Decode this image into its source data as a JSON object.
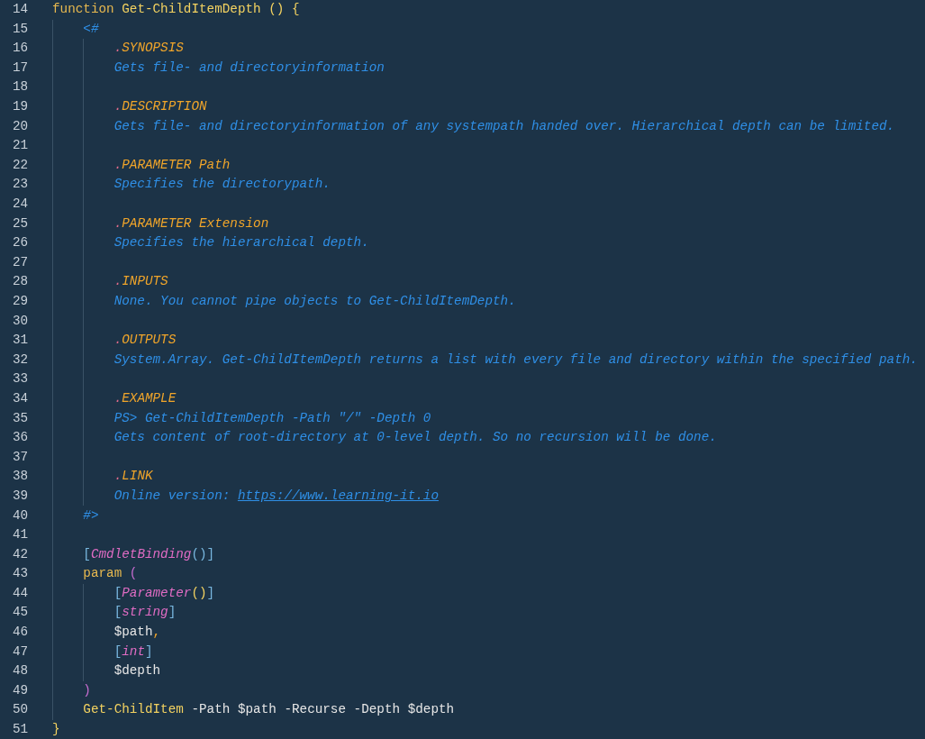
{
  "editor": {
    "lines": [
      {
        "number": "14",
        "tokens": [
          {
            "kind": "keyword",
            "text": "function "
          },
          {
            "kind": "function",
            "text": "Get-ChildItemDepth "
          },
          {
            "kind": "paren-yellow",
            "text": "() {"
          }
        ],
        "children": [
          {
            "number": "15",
            "tokens": [
              {
                "kind": "comment",
                "text": "<#"
              }
            ],
            "children": [
              {
                "number": "16",
                "tokens": [
                  {
                    "kind": "doc-dot",
                    "text": "."
                  },
                  {
                    "kind": "doc-keyword",
                    "text": "SYNOPSIS"
                  }
                ]
              },
              {
                "number": "17",
                "tokens": [
                  {
                    "kind": "comment",
                    "text": "Gets file- and directoryinformation"
                  }
                ]
              },
              {
                "number": "18"
              },
              {
                "number": "19",
                "tokens": [
                  {
                    "kind": "doc-dot",
                    "text": "."
                  },
                  {
                    "kind": "doc-keyword",
                    "text": "DESCRIPTION"
                  }
                ]
              },
              {
                "number": "20",
                "tokens": [
                  {
                    "kind": "comment",
                    "text": "Gets file- and directoryinformation of any systempath handed over. Hierarchical depth can be limited."
                  }
                ]
              },
              {
                "number": "21"
              },
              {
                "number": "22",
                "tokens": [
                  {
                    "kind": "doc-dot",
                    "text": "."
                  },
                  {
                    "kind": "doc-keyword",
                    "text": "PARAMETER Path"
                  }
                ]
              },
              {
                "number": "23",
                "tokens": [
                  {
                    "kind": "comment",
                    "text": "Specifies the directorypath."
                  }
                ]
              },
              {
                "number": "24"
              },
              {
                "number": "25",
                "tokens": [
                  {
                    "kind": "doc-dot",
                    "text": "."
                  },
                  {
                    "kind": "doc-keyword",
                    "text": "PARAMETER Extension"
                  }
                ]
              },
              {
                "number": "26",
                "tokens": [
                  {
                    "kind": "comment",
                    "text": "Specifies the hierarchical depth."
                  }
                ]
              },
              {
                "number": "27"
              },
              {
                "number": "28",
                "tokens": [
                  {
                    "kind": "doc-dot",
                    "text": "."
                  },
                  {
                    "kind": "doc-keyword",
                    "text": "INPUTS"
                  }
                ]
              },
              {
                "number": "29",
                "tokens": [
                  {
                    "kind": "comment",
                    "text": "None. You cannot pipe objects to Get-ChildItemDepth."
                  }
                ]
              },
              {
                "number": "30"
              },
              {
                "number": "31",
                "tokens": [
                  {
                    "kind": "doc-dot",
                    "text": "."
                  },
                  {
                    "kind": "doc-keyword",
                    "text": "OUTPUTS"
                  }
                ]
              },
              {
                "number": "32",
                "tokens": [
                  {
                    "kind": "comment",
                    "text": "System.Array. Get-ChildItemDepth returns a list with every file and directory within the specified path."
                  }
                ]
              },
              {
                "number": "33"
              },
              {
                "number": "34",
                "tokens": [
                  {
                    "kind": "doc-dot",
                    "text": "."
                  },
                  {
                    "kind": "doc-keyword",
                    "text": "EXAMPLE"
                  }
                ]
              },
              {
                "number": "35",
                "tokens": [
                  {
                    "kind": "comment",
                    "text": "PS> Get-ChildItemDepth -Path \"/\" -Depth 0"
                  }
                ]
              },
              {
                "number": "36",
                "tokens": [
                  {
                    "kind": "comment",
                    "text": "Gets content of root-directory at 0-level depth. So no recursion will be done."
                  }
                ]
              },
              {
                "number": "37"
              },
              {
                "number": "38",
                "tokens": [
                  {
                    "kind": "doc-dot",
                    "text": "."
                  },
                  {
                    "kind": "doc-keyword",
                    "text": "LINK"
                  }
                ]
              },
              {
                "number": "39",
                "tokens": [
                  {
                    "kind": "comment",
                    "text": "Online version: "
                  },
                  {
                    "kind": "link",
                    "text": "https://www.learning-it.io"
                  }
                ]
              }
            ]
          },
          {
            "number": "40",
            "tokens": [
              {
                "kind": "comment",
                "text": "#>"
              }
            ]
          },
          {
            "number": "41"
          },
          {
            "number": "42",
            "tokens": [
              {
                "kind": "bracket",
                "text": "["
              },
              {
                "kind": "type",
                "text": "CmdletBinding"
              },
              {
                "kind": "bracket",
                "text": "()]"
              }
            ]
          },
          {
            "number": "43",
            "tokens": [
              {
                "kind": "keyword",
                "text": "param "
              },
              {
                "kind": "paren-pink",
                "text": "("
              }
            ],
            "children": [
              {
                "number": "44",
                "tokens": [
                  {
                    "kind": "bracket",
                    "text": "["
                  },
                  {
                    "kind": "type",
                    "text": "Parameter"
                  },
                  {
                    "kind": "paren-yellow",
                    "text": "()"
                  },
                  {
                    "kind": "bracket",
                    "text": "]"
                  }
                ]
              },
              {
                "number": "45",
                "tokens": [
                  {
                    "kind": "bracket",
                    "text": "["
                  },
                  {
                    "kind": "type",
                    "text": "string"
                  },
                  {
                    "kind": "bracket",
                    "text": "]"
                  }
                ]
              },
              {
                "number": "46",
                "tokens": [
                  {
                    "kind": "variable",
                    "text": "$path"
                  },
                  {
                    "kind": "comma",
                    "text": ","
                  }
                ]
              },
              {
                "number": "47",
                "tokens": [
                  {
                    "kind": "bracket",
                    "text": "["
                  },
                  {
                    "kind": "type",
                    "text": "int"
                  },
                  {
                    "kind": "bracket",
                    "text": "]"
                  }
                ]
              },
              {
                "number": "48",
                "tokens": [
                  {
                    "kind": "variable",
                    "text": "$depth"
                  }
                ]
              }
            ]
          },
          {
            "number": "49",
            "tokens": [
              {
                "kind": "paren-pink",
                "text": ")"
              }
            ]
          },
          {
            "number": "50",
            "tokens": [
              {
                "kind": "function",
                "text": "Get-ChildItem"
              },
              {
                "kind": "variable",
                "text": " -Path $path -Recurse -Depth $depth"
              }
            ]
          }
        ]
      },
      {
        "number": "51",
        "tokens": [
          {
            "kind": "paren-yellow",
            "text": "}"
          }
        ]
      }
    ]
  }
}
